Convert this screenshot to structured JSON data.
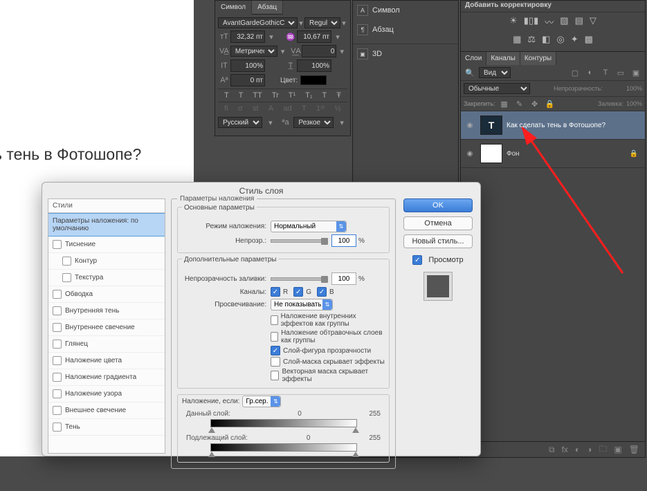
{
  "canvas": {
    "text": "ь тень в Фотошопе?"
  },
  "char_panel": {
    "tabs": [
      "Символ",
      "Абзац"
    ],
    "font": "AvantGardeGothicC",
    "style": "Regular",
    "size": "32,32 пт",
    "leading": "10,67 пт",
    "metrics": "Метрический",
    "tracking": "0",
    "vscale": "100%",
    "hscale": "100%",
    "baseline": "0 пт",
    "color_label": "Цвет:",
    "glyph_row1": [
      "T",
      "T",
      "TT",
      "Tr",
      "T¹",
      "T₁",
      "T",
      "Ŧ"
    ],
    "glyph_row2": [
      "fi",
      "σ",
      "st",
      "A",
      "ad",
      "T",
      "1ˢᵗ",
      "½"
    ],
    "lang": "Русский",
    "aa": "Резкое"
  },
  "right_side": {
    "items": [
      {
        "label": "Символ",
        "icon": "A"
      },
      {
        "label": "Абзац",
        "icon": "¶"
      },
      {
        "label": "3D",
        "icon": "3d"
      }
    ]
  },
  "adjustments": {
    "title": "Добавить корректировку",
    "row1": [
      "sun",
      "levels",
      "curves",
      "exposure",
      "film",
      "grid"
    ],
    "row2": [
      "vibrance",
      "color-balance",
      "bw",
      "photo-filter",
      "channel-mixer",
      "color-lookup"
    ],
    "row3": [
      "invert",
      "posterize",
      "threshold",
      "selective-color",
      "gradient-map"
    ]
  },
  "layers_panel": {
    "tabs": [
      "Слои",
      "Каналы",
      "Контуры"
    ],
    "kind": "Вид",
    "blend_mode": "Обычные",
    "opacity_label": "Непрозрачность:",
    "opacity_value": "100%",
    "lock_label": "Закрепить:",
    "fill_label": "Заливка:",
    "fill_value": "100%",
    "items": [
      {
        "name": "Как сделать тень в Фотошопе?",
        "type": "text",
        "selected": true
      },
      {
        "name": "Фон",
        "type": "bg",
        "locked": true
      }
    ]
  },
  "dialog": {
    "title": "Стиль слоя",
    "styles_header": "Стили",
    "blending_default": "Параметры наложения: по умолчанию",
    "effects": [
      "Тиснение",
      "Контур",
      "Текстура",
      "Обводка",
      "Внутренняя тень",
      "Внутреннее свечение",
      "Глянец",
      "Наложение цвета",
      "Наложение градиента",
      "Наложение узора",
      "Внешнее свечение",
      "Тень"
    ],
    "main_fieldset": "Параметры наложения",
    "basic_fieldset": "Основные параметры",
    "blend_mode_label": "Режим наложения:",
    "blend_mode_value": "Нормальный",
    "opac_label": "Непрозр.:",
    "opac_value": "100",
    "percent": "%",
    "adv_fieldset": "Дополнительные параметры",
    "fill_opac_label": "Непрозрачность заливки:",
    "fill_opac_value": "100",
    "channels_label": "Каналы:",
    "ch_r": "R",
    "ch_g": "G",
    "ch_b": "B",
    "knockout_label": "Просвечивание:",
    "knockout_value": "Не показывать",
    "check_lines": [
      {
        "label": "Наложение внутренних эффектов как группы",
        "checked": false
      },
      {
        "label": "Наложение обтравочных слоев как группы",
        "checked": false
      },
      {
        "label": "Слой-фигура прозрачности",
        "checked": true
      },
      {
        "label": "Слой-маска скрывает эффекты",
        "checked": false
      },
      {
        "label": "Векторная маска скрывает эффекты",
        "checked": false
      }
    ],
    "blend_if_label": "Наложение, если:",
    "blend_if_value": "Гр.сер.",
    "this_layer_label": "Данный слой:",
    "under_layer_label": "Подлежащий слой:",
    "range_lo": "0",
    "range_hi": "255",
    "ok": "OK",
    "cancel": "Отмена",
    "new_style": "Новый стиль...",
    "preview_label": "Просмотр"
  }
}
